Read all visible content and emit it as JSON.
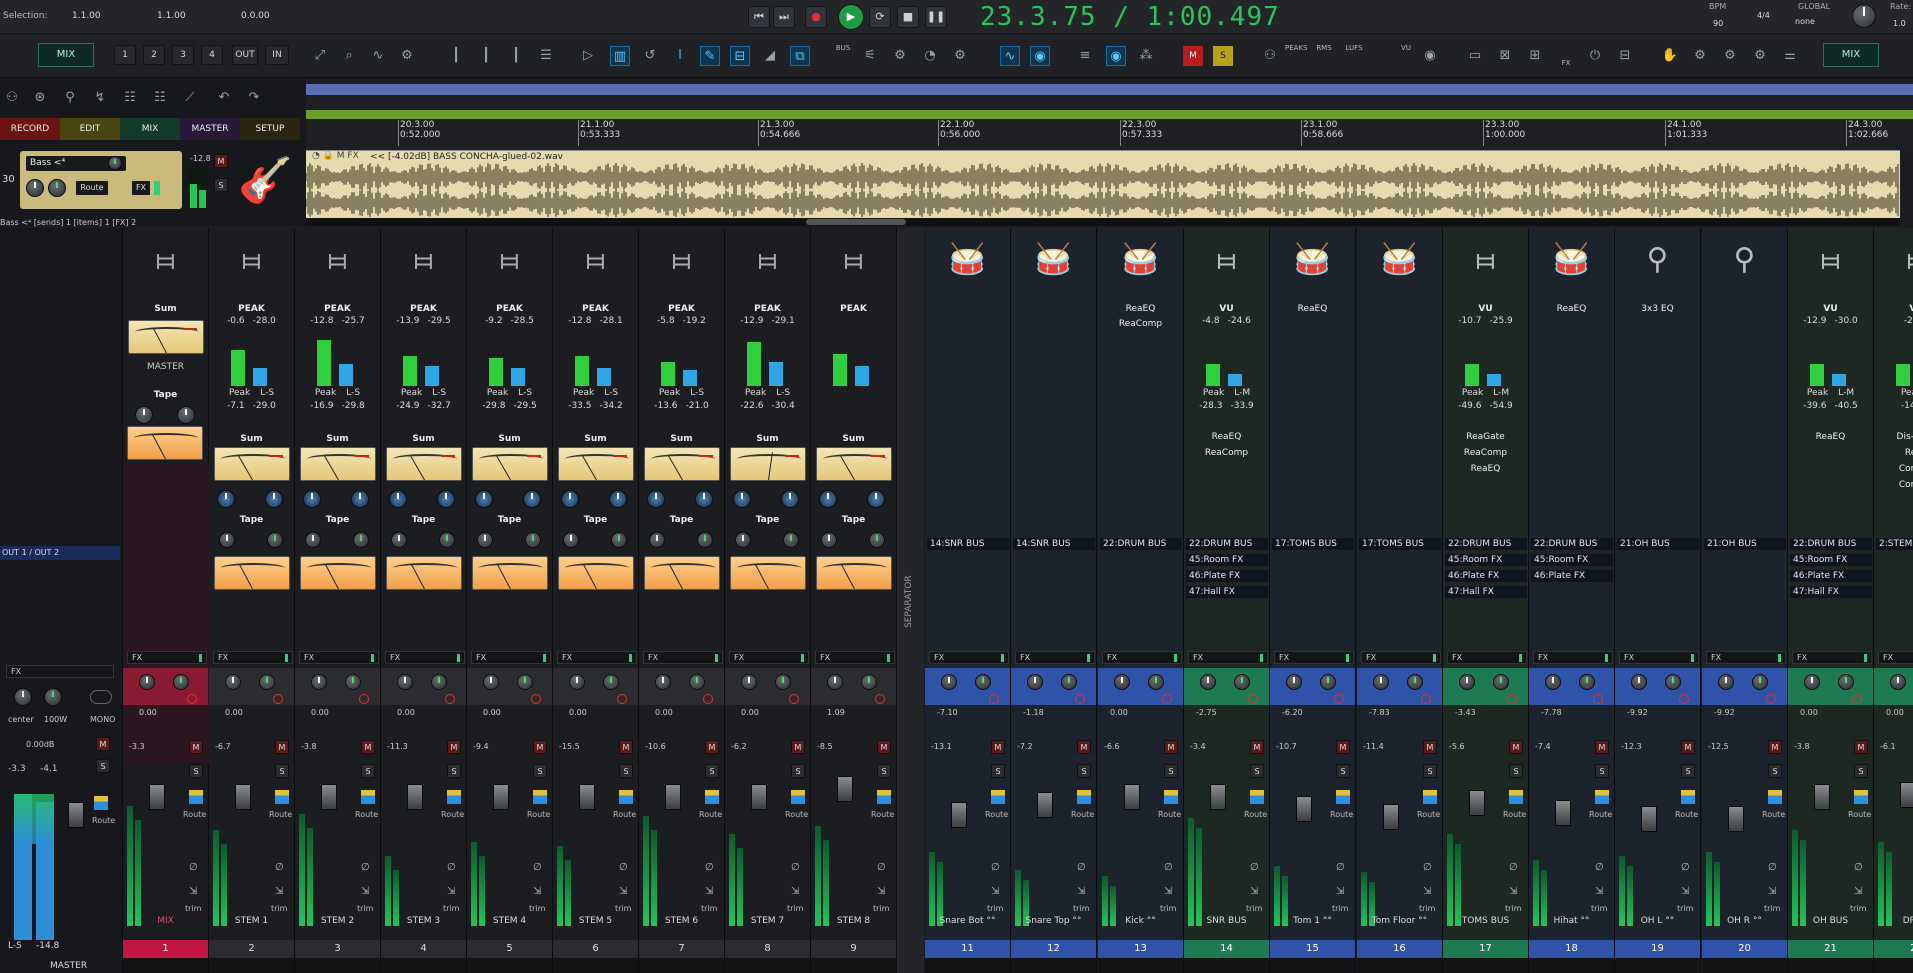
{
  "topbar": {
    "selection_label": "Selection:",
    "sel_start": "1.1.00",
    "sel_end": "1.1.00",
    "sel_len": "0.0.00",
    "time_display": "23.3.75 / 1:00.497",
    "bpm_label": "BPM",
    "bpm_value": "90",
    "timesig": "4/4",
    "global_label": "GLOBAL",
    "global_value": "none",
    "rate_label": "Rate:",
    "rate_value": "1.0"
  },
  "transport": {
    "icons": [
      "skip-back-icon",
      "skip-forward-icon",
      "record-icon",
      "play-icon",
      "loop-icon",
      "stop-icon",
      "pause-icon"
    ]
  },
  "toolbar2": {
    "mix_left": "MIX",
    "mix_right": "MIX",
    "buttons": [
      "1",
      "2",
      "3",
      "4",
      "OUT",
      "IN"
    ],
    "bus_label": "BUS",
    "peaks_label": "PEAKS",
    "rms_label": "RMS",
    "lufs_label": "LUFS",
    "vu_label": "VU",
    "fx_label": "FX"
  },
  "left": {
    "tabs": [
      "RECORD",
      "EDIT",
      "MIX",
      "MASTER",
      "SETUP"
    ],
    "track_number": "30",
    "track_name": "Bass <⁴",
    "fx_btn": "FX",
    "route_btn": "Route",
    "meter_val": "-12.8",
    "m_btn": "M",
    "s_btn": "S",
    "status": "Bass <⁴ [sends] 1 [items] 1 [FX] 2"
  },
  "timeline": {
    "marks": [
      {
        "bar": "20.3.00",
        "time": "0:52.000"
      },
      {
        "bar": "21.1.00",
        "time": "0:53.333"
      },
      {
        "bar": "21.3.00",
        "time": "0:54.666"
      },
      {
        "bar": "22.1.00",
        "time": "0:56.000"
      },
      {
        "bar": "22.3.00",
        "time": "0:57.333"
      },
      {
        "bar": "23.1.00",
        "time": "0:58.666"
      },
      {
        "bar": "23.3.00",
        "time": "1:00.000"
      },
      {
        "bar": "24.1.00",
        "time": "1:01.333"
      },
      {
        "bar": "24.3.00",
        "time": "1:02.666"
      }
    ],
    "item_label": "<< [-4.02dB] BASS CONCHA-glued-02.wav"
  },
  "master": {
    "out_label": "OUT 1 / OUT 2",
    "sum_label": "Sum",
    "master_label": "MASTER",
    "tape_label": "Tape",
    "fx_label": "FX",
    "pan_label": "center",
    "width_label": "100W",
    "mono_label": "MONO",
    "vol": "0.00dB",
    "peak_l": "-3.3",
    "peak_r": "-4.1",
    "ls_label": "L-S",
    "ls_val": "-14.8",
    "route": "Route",
    "bottom": "MASTER"
  },
  "strips": [
    {
      "name": "MIX",
      "num": "1",
      "color": "#c0163f",
      "pk": "-7.8",
      "pk2": "-31.5",
      "l1": "Peak",
      "l2": "L-S",
      "v1": "-16.4",
      "v2": "-35.0",
      "vol": "0.00",
      "mtr": "-3.3"
    },
    {
      "name": "STEM 1",
      "num": "2",
      "color": "#1d1e21",
      "pk": "-0.6",
      "pk2": "-28.0",
      "l1": "Peak",
      "l2": "L-S",
      "v1": "-7.1",
      "v2": "-29.0",
      "vol": "0.00",
      "mtr": "-6.7"
    },
    {
      "name": "STEM 2",
      "num": "3",
      "color": "#1d1e21",
      "pk": "-12.8",
      "pk2": "-25.7",
      "l1": "Peak",
      "l2": "L-S",
      "v1": "-16.9",
      "v2": "-29.8",
      "vol": "0.00",
      "mtr": "-3.8"
    },
    {
      "name": "STEM 3",
      "num": "4",
      "color": "#1d1e21",
      "pk": "-13.9",
      "pk2": "-29.5",
      "l1": "Peak",
      "l2": "L-S",
      "v1": "-24.9",
      "v2": "-32.7",
      "vol": "0.00",
      "mtr": "-11.3"
    },
    {
      "name": "STEM 4",
      "num": "5",
      "color": "#1d1e21",
      "pk": "-9.2",
      "pk2": "-28.5",
      "l1": "Peak",
      "l2": "L-S",
      "v1": "-29.8",
      "v2": "-29.5",
      "vol": "0.00",
      "mtr": "-9.4"
    },
    {
      "name": "STEM 5",
      "num": "6",
      "color": "#1d1e21",
      "pk": "-12.8",
      "pk2": "-28.1",
      "l1": "Peak",
      "l2": "L-S",
      "v1": "-33.5",
      "v2": "-34.2",
      "vol": "0.00",
      "mtr": "-15.5"
    },
    {
      "name": "STEM 6",
      "num": "7",
      "color": "#1d1e21",
      "pk": "-5.8",
      "pk2": "-19.2",
      "l1": "Peak",
      "l2": "L-S",
      "v1": "-13.6",
      "v2": "-21.0",
      "vol": "0.00",
      "mtr": "-10.6"
    },
    {
      "name": "STEM 7",
      "num": "8",
      "color": "#1d1e21",
      "pk": "-12.9",
      "pk2": "-29.1",
      "l1": "Peak",
      "l2": "L-S",
      "v1": "-22.6",
      "v2": "-30.4",
      "vol": "0.00",
      "mtr": "-6.2"
    },
    {
      "name": "STEM 8",
      "num": "9",
      "color": "#1d1e21",
      "pk": "",
      "pk2": "",
      "l1": "",
      "l2": "",
      "v1": "",
      "v2": "",
      "vol": "1.09",
      "mtr": "-8.5"
    }
  ],
  "strip_labels": {
    "peak": "PEAK",
    "sum": "Sum",
    "tape": "Tape",
    "fx": "FX",
    "route": "Route",
    "m": "M",
    "s": "S",
    "trim": "trim"
  },
  "separator": "SEPARATOR",
  "drum_strips": [
    {
      "name": "Snare Bot °°",
      "num": "11",
      "head": "#2e53a8",
      "fx1": "",
      "fx2": "",
      "send": "14:SNR BUS",
      "vol": "-7.10",
      "mtr": "-13.1"
    },
    {
      "name": "Snare Top °°",
      "num": "12",
      "head": "#2e53a8",
      "fx1": "",
      "fx2": "",
      "send": "14:SNR BUS",
      "vol": "-1.18",
      "mtr": "-7.2"
    },
    {
      "name": "Kick °°",
      "num": "13",
      "head": "#2e53a8",
      "fx1": "ReaEQ",
      "fx2": "ReaComp",
      "send": "22:DRUM BUS",
      "vol": "0.00",
      "mtr": "-6.6"
    },
    {
      "name": "SNR BUS",
      "num": "14",
      "head": "#1e7a52",
      "fx1": "VU",
      "fx2": "",
      "send": "22:DRUM BUS",
      "vol": "-2.75",
      "mtr": "-3.4",
      "extra": [
        "45:Room FX",
        "46:Plate FX",
        "47:Hall FX"
      ]
    },
    {
      "name": "Tom 1 °°",
      "num": "15",
      "head": "#2e53a8",
      "fx1": "ReaEQ",
      "fx2": "",
      "send": "17:TOMS BUS",
      "vol": "-6.20",
      "mtr": "-10.7"
    },
    {
      "name": "Tom Floor °°",
      "num": "16",
      "head": "#2e53a8",
      "fx1": "",
      "fx2": "",
      "send": "17:TOMS BUS",
      "vol": "-7.83",
      "mtr": "-11.4"
    },
    {
      "name": "TOMS BUS",
      "num": "17",
      "head": "#1e7a52",
      "fx1": "VU",
      "fx2": "",
      "send": "22:DRUM BUS",
      "vol": "-3.43",
      "mtr": "-5.6",
      "extra": [
        "45:Room FX",
        "46:Plate FX",
        "47:Hall FX"
      ]
    },
    {
      "name": "Hihat °°",
      "num": "18",
      "head": "#2e53a8",
      "fx1": "ReaEQ",
      "fx2": "",
      "send": "22:DRUM BUS",
      "vol": "-7.78",
      "mtr": "-7.4",
      "extra": [
        "45:Room FX",
        "46:Plate FX"
      ]
    },
    {
      "name": "OH L °°",
      "num": "19",
      "head": "#2e53a8",
      "fx1": "3x3 EQ",
      "fx2": "",
      "send": "21:OH BUS",
      "vol": "-9.92",
      "mtr": "-12.3"
    },
    {
      "name": "OH R °°",
      "num": "20",
      "head": "#2e53a8",
      "fx1": "",
      "fx2": "",
      "send": "21:OH BUS",
      "vol": "-9.92",
      "mtr": "-12.5"
    },
    {
      "name": "OH BUS",
      "num": "21",
      "head": "#1e7a52",
      "fx1": "VU",
      "fx2": "",
      "send": "22:DRUM BUS",
      "vol": "0.00",
      "mtr": "-3.8",
      "extra": [
        "45:Room FX",
        "46:Plate FX",
        "47:Hall FX"
      ]
    },
    {
      "name": "DRUM",
      "num": "22",
      "head": "#1e7a52",
      "fx1": "VU",
      "fx2": "",
      "send": "2:STEM 1",
      "vol": "0.00",
      "mtr": "-6.1"
    }
  ],
  "vu_strips": {
    "14": {
      "pk": "-4.8",
      "pk2": "-24.6",
      "l1": "Peak",
      "l2": "L-M",
      "v1": "-28.3",
      "v2": "-33.9",
      "post": [
        "ReaEQ",
        "ReaComp"
      ]
    },
    "17": {
      "pk": "-10.7",
      "pk2": "-25.9",
      "l1": "Peak",
      "l2": "L-M",
      "v1": "-49.6",
      "v2": "-54.9",
      "post": [
        "ReaGate",
        "ReaComp",
        "ReaEQ"
      ]
    },
    "21": {
      "pk": "-12.9",
      "pk2": "-30.0",
      "l1": "Peak",
      "l2": "L-M",
      "v1": "-39.6",
      "v2": "-40.5",
      "post": [
        "ReaEQ"
      ]
    },
    "22": {
      "pk": "-2.4",
      "pk2": "",
      "l1": "Peak",
      "l2": "",
      "v1": "-14.2",
      "v2": "",
      "post": [
        "Dis-Treas",
        "ReaC",
        "Compre",
        "Compre"
      ]
    }
  }
}
